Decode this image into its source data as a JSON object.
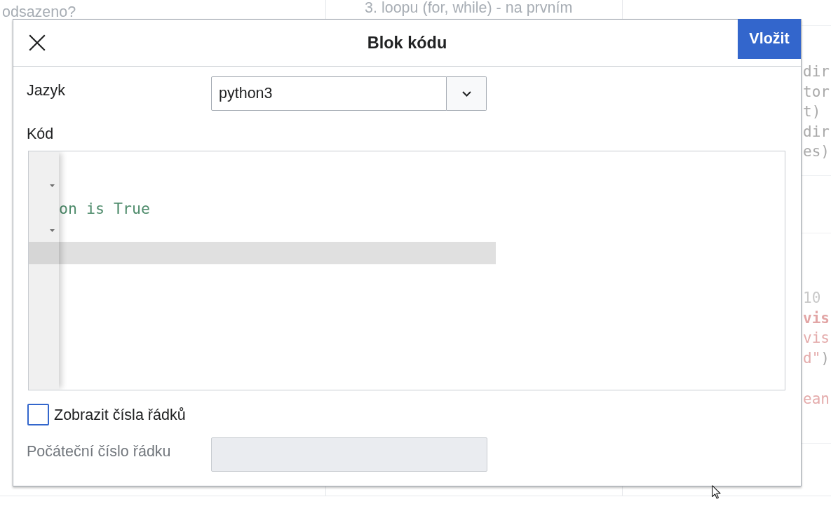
{
  "background_page": {
    "column_1_text": "odsazeno?",
    "column_2_text": "3. loopu (for, while) - na prvním",
    "code_blocks": [
      {
        "lines": [
          {
            "tokens": [
              {
                "text": "dir",
                "kind": "plain"
              }
            ]
          },
          {
            "tokens": [
              {
                "text": "tor",
                "kind": "plain"
              }
            ]
          },
          {
            "tokens": [
              {
                "text": "t)",
                "kind": "plain"
              }
            ]
          },
          {
            "tokens": [
              {
                "text": "dir",
                "kind": "plain"
              }
            ]
          },
          {
            "tokens": [
              {
                "text": "es)",
                "kind": "plain"
              }
            ]
          }
        ]
      },
      {
        "lines": [
          {
            "tokens": [
              {
                "text": "10",
                "kind": "number"
              }
            ]
          },
          {
            "tokens": [
              {
                "text": "vis",
                "kind": "keyword"
              }
            ]
          },
          {
            "tokens": [
              {
                "text": "vis",
                "kind": "string"
              }
            ]
          },
          {
            "tokens": [
              {
                "text": "d\"",
                "kind": "string"
              },
              {
                "text": ")",
                "kind": "plain"
              }
            ]
          }
        ]
      },
      {
        "lines": [
          {
            "tokens": [
              {
                "text": "ean",
                "kind": "string"
              }
            ]
          }
        ]
      }
    ]
  },
  "dialog": {
    "title": "Blok kódu",
    "insert_button": "Vložit",
    "language": {
      "label": "Jazyk",
      "value": "python3"
    },
    "code": {
      "label": "Kód",
      "lines": [
        {
          "fold_marker": false,
          "active": false
        },
        {
          "fold_marker": true,
          "active": false
        },
        {
          "text": "on is True",
          "fold_marker": false,
          "active": false
        },
        {
          "fold_marker": true,
          "active": false
        },
        {
          "fold_marker": false,
          "active": true
        }
      ]
    },
    "show_line_numbers": {
      "label": "Zobrazit čísla řádků",
      "checked": false
    },
    "start_line": {
      "label": "Počáteční číslo řádku",
      "disabled": true
    }
  }
}
